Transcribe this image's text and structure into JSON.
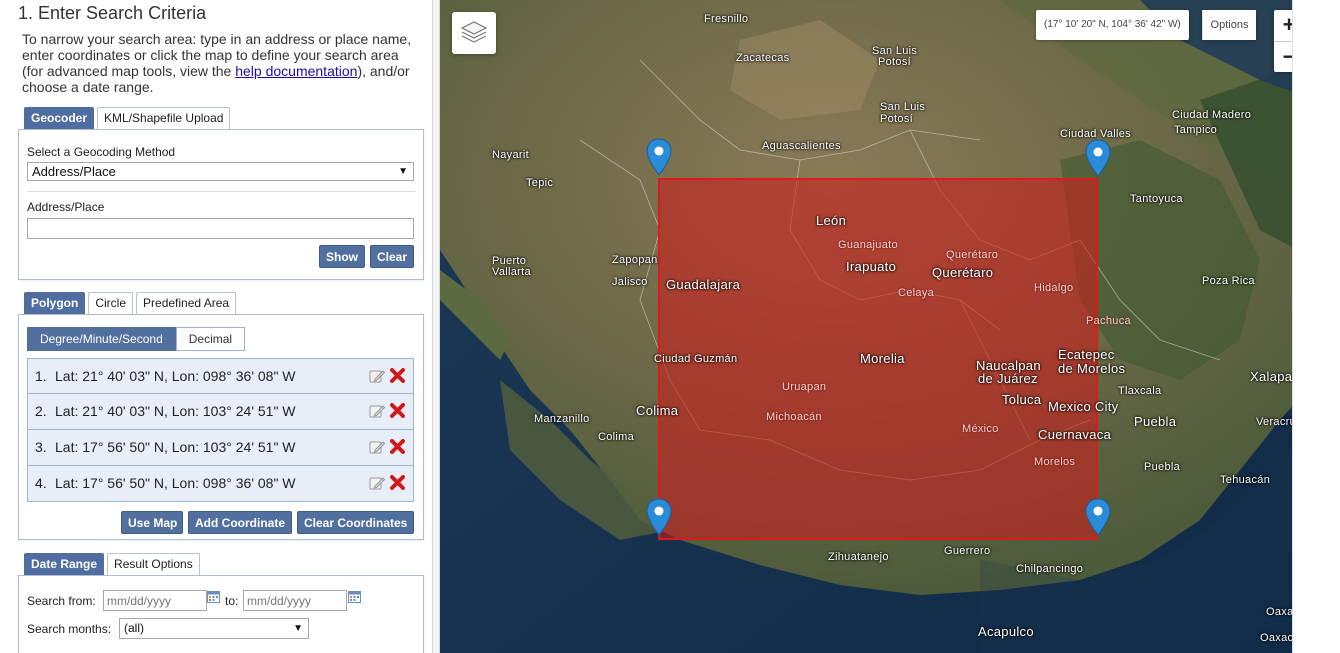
{
  "header": {
    "title": "1. Enter Search Criteria",
    "intro_before": "To narrow your search area: type in an address or place name, enter coordinates or click the map to define your search area (for advanced map tools, view the ",
    "intro_link": "help documentation",
    "intro_after": "), and/or choose a date range."
  },
  "geocoder_tabs": [
    "Geocoder",
    "KML/Shapefile Upload"
  ],
  "geocoder": {
    "method_label": "Select a Geocoding Method",
    "method_value": "Address/Place",
    "address_label": "Address/Place",
    "address_value": "",
    "show_label": "Show",
    "clear_label": "Clear"
  },
  "area_tabs": [
    "Polygon",
    "Circle",
    "Predefined Area"
  ],
  "coord_format_tabs": [
    "Degree/Minute/Second",
    "Decimal"
  ],
  "coordinates": [
    {
      "num": "1.",
      "text": "Lat: 21° 40' 03\" N, Lon: 098° 36' 08\" W"
    },
    {
      "num": "2.",
      "text": "Lat: 21° 40' 03\" N, Lon: 103° 24' 51\" W"
    },
    {
      "num": "3.",
      "text": "Lat: 17° 56' 50\" N, Lon: 103° 24' 51\" W"
    },
    {
      "num": "4.",
      "text": "Lat: 17° 56' 50\" N, Lon: 098° 36' 08\" W"
    }
  ],
  "coord_actions": {
    "use_map": "Use Map",
    "add_coordinate": "Add Coordinate",
    "clear_coordinates": "Clear Coordinates"
  },
  "date_tabs": [
    "Date Range",
    "Result Options"
  ],
  "date_range": {
    "from_label": "Search from:",
    "from_placeholder": "mm/dd/yyyy",
    "to_label": "to:",
    "to_placeholder": "mm/dd/yyyy",
    "months_label": "Search months:",
    "months_value": "(all)"
  },
  "map": {
    "coord_readout": "(17° 10' 20\" N, 104° 36' 42\" W)",
    "options_label": "Options",
    "zoom_in": "+",
    "zoom_out": "−",
    "labels": [
      "Fresnillo",
      "Zacatecas",
      "San Luis",
      "Potosí",
      "San Luis",
      "Potosí",
      "Aguascalientes",
      "Nayarit",
      "Tepic",
      "Ciudad Valles",
      "Ciudad Madero",
      "Tampico",
      "Tantoyuca",
      "Puerto",
      "Vallarta",
      "Zapopan",
      "Jalisco",
      "Guadalajara",
      "León",
      "Guanajuato",
      "Irapuato",
      "Querétaro",
      "Querétaro",
      "Celaya",
      "Hidalgo",
      "Pachuca",
      "Poza Rica",
      "Ciudad Guzmán",
      "Morelia",
      "Naucalpan",
      "de Juárez",
      "Ecatepec",
      "de Morelos",
      "Tlaxcala",
      "Xalapa",
      "Uruapan",
      "Manzanillo",
      "Colima",
      "Colima",
      "Michoacán",
      "Toluca",
      "Mexico City",
      "México",
      "Puebla",
      "Veracruz",
      "Cuernavaca",
      "Puebla",
      "Morelos",
      "Tehuacán",
      "Zihuatanejo",
      "Guerrero",
      "Chilpancingo",
      "Oaxaca",
      "Acapulco",
      "Oaxaca"
    ]
  },
  "colors": {
    "accent": "#52709f",
    "polygon_fill": "#ce1c1c",
    "pin": "#2a8bd8",
    "delete": "#d01818"
  },
  "icons": {
    "layers": "layers-icon",
    "edit": "edit-icon",
    "delete": "delete-icon",
    "calendar": "calendar-icon",
    "pin": "map-pin-icon"
  }
}
